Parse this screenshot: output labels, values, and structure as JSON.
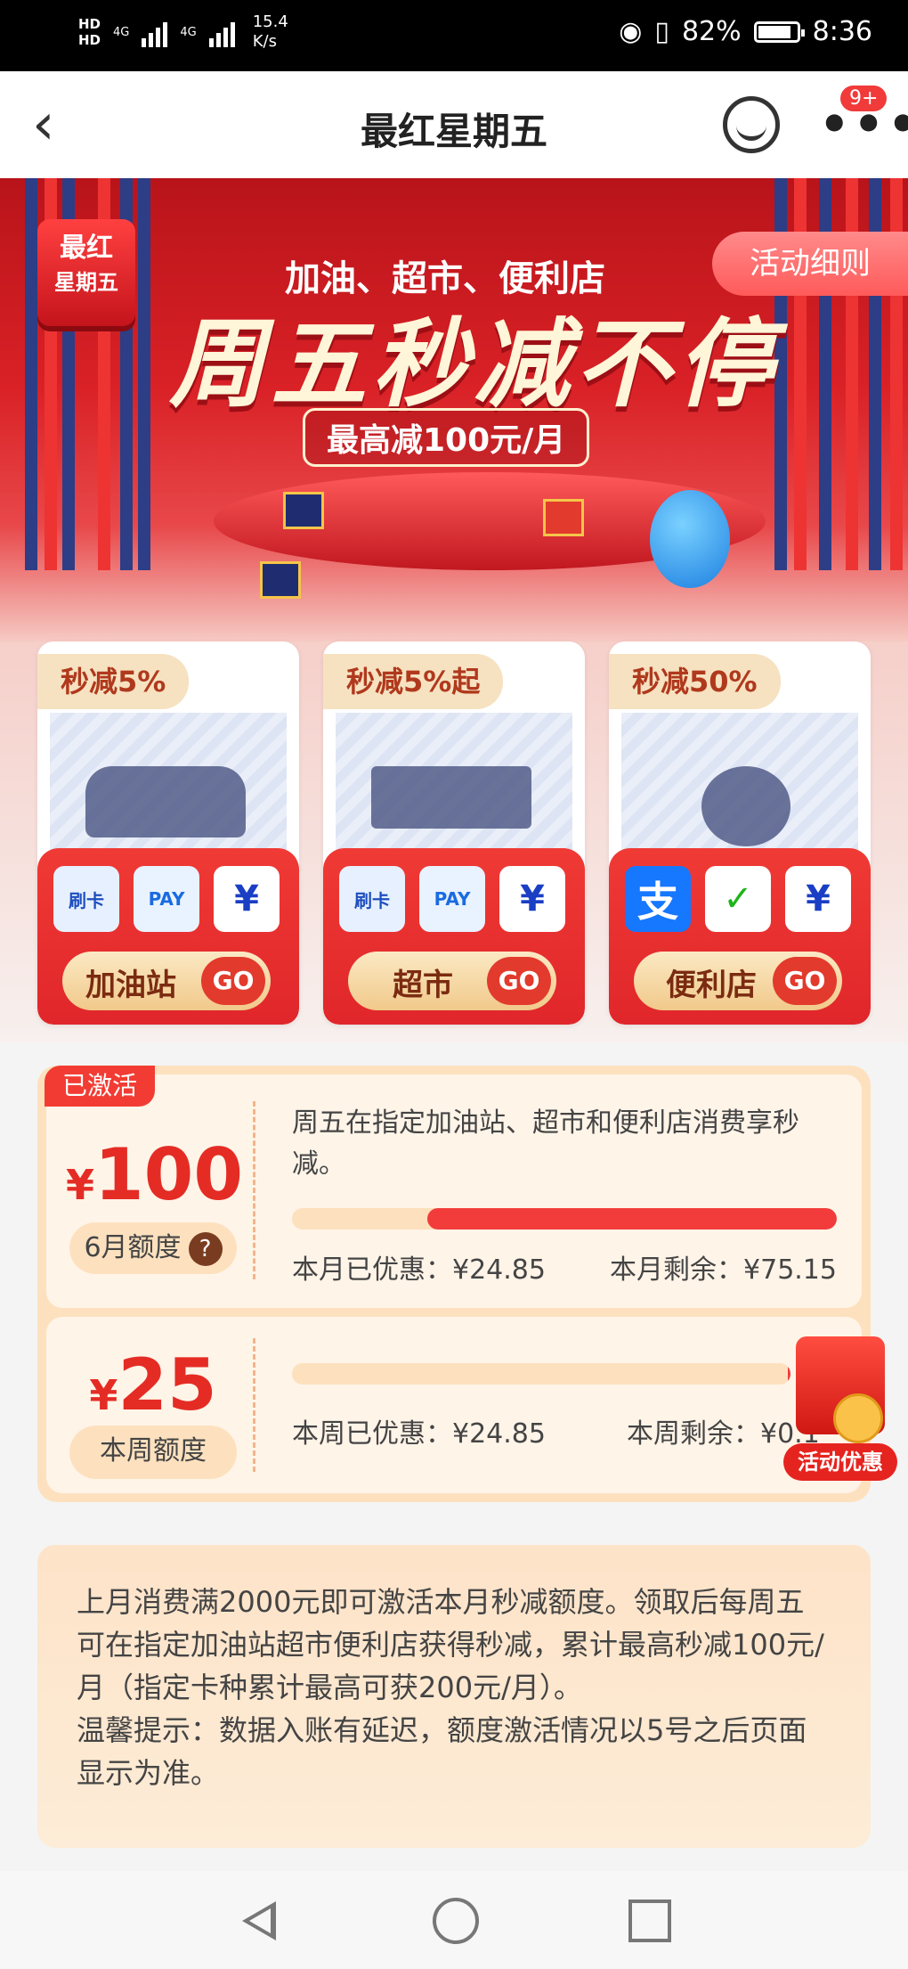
{
  "status_bar": {
    "hd1": "HD",
    "hd2": "HD",
    "net1": "4G",
    "net2": "4G",
    "speed_value": "15.4",
    "speed_unit": "K/s",
    "battery": "82%",
    "time": "8:36"
  },
  "navbar": {
    "title": "最红星期五",
    "badge": "9+"
  },
  "banner": {
    "logo_line1": "最红",
    "logo_line2": "星期五",
    "subline": "加油、超市、便利店",
    "headline": "周五秒减不停",
    "cap": "最高减100元/月",
    "rules_button": "活动细则"
  },
  "cards": [
    {
      "tag": "秒减5%",
      "label": "加油站",
      "go": "GO",
      "pay": [
        "刷卡",
        "PAY",
        "¥"
      ]
    },
    {
      "tag": "秒减5%起",
      "label": "超市",
      "go": "GO",
      "pay": [
        "刷卡",
        "PAY",
        "¥"
      ]
    },
    {
      "tag": "秒减50%",
      "label": "便利店",
      "go": "GO",
      "pay": [
        "支",
        "✓",
        "¥"
      ]
    }
  ],
  "quota": {
    "activated": "已激活",
    "month": {
      "yen": "¥",
      "amount": "100",
      "label": "6月额度",
      "help": "?",
      "desc": "周五在指定加油站、超市和便利店消费享秒减。",
      "used": "本月已优惠：¥24.85",
      "remaining": "本月剩余：¥75.15",
      "remaining_fraction": 0.7515
    },
    "week": {
      "yen": "¥",
      "amount": "25",
      "label": "本周额度",
      "used": "本周已优惠：¥24.85",
      "remaining": "本周剩余：¥0.1",
      "remaining_fraction": 0.006
    }
  },
  "promo_label": "活动优惠",
  "info": {
    "p1": "上月消费满2000元即可激活本月秒减额度。领取后每周五可在指定加油站超市便利店获得秒减，累计最高秒减100元/月（指定卡种累计最高可获200元/月）。",
    "p2": "温馨提示：数据入账有延迟，额度激活情况以5号之后页面显示为准。"
  },
  "colors": {
    "accent_red": "#f23c33",
    "banner_red": "#d92126",
    "gold": "#f1c98a"
  }
}
